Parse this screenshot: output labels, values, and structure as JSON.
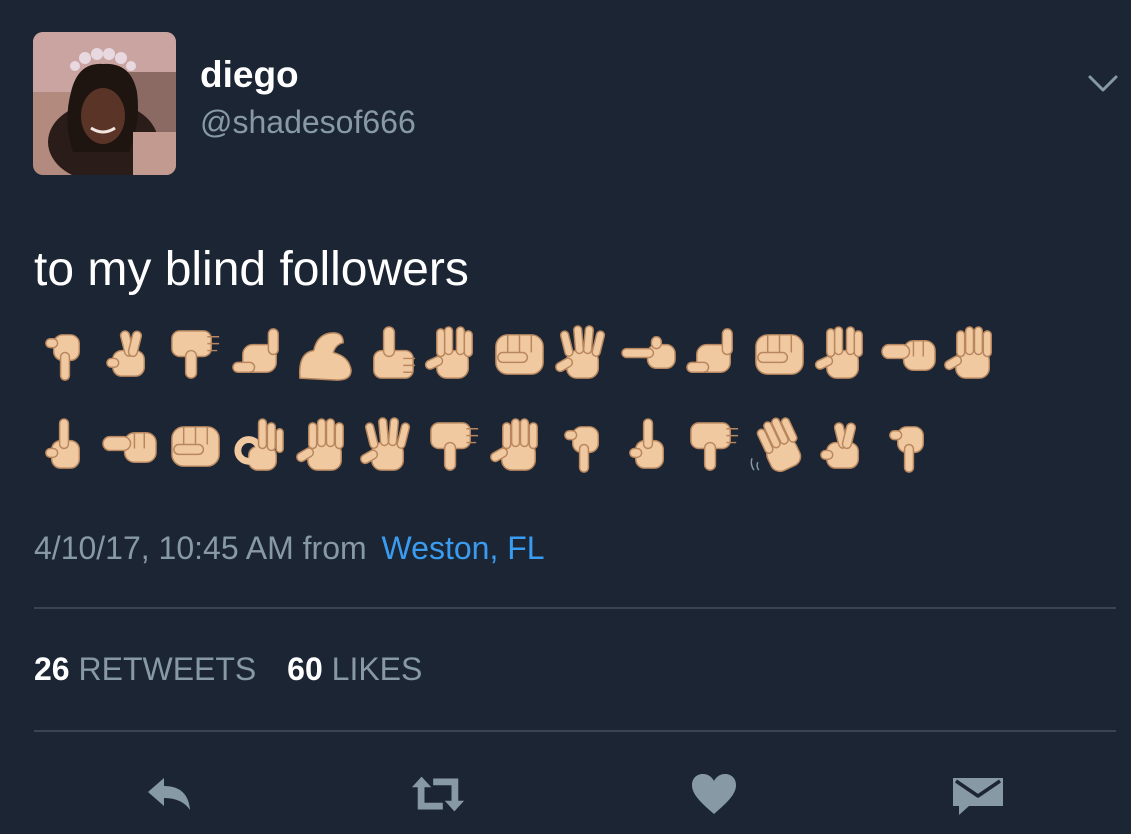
{
  "tweet": {
    "display_name": "diego",
    "username": "@shadesof666",
    "text": "to my blind followers",
    "emoji_rows": [
      [
        "point-down",
        "crossed-fingers",
        "thumbs-down",
        "call-me-hand",
        "flexed-biceps",
        "thumbs-up",
        "vulcan-salute",
        "fist-bump",
        "splayed-hand",
        "point-left",
        "call-me-hand",
        "fist-bump",
        "vulcan-salute",
        "fist-right",
        "raised-hand"
      ],
      [
        "point-up",
        "fist-right",
        "fist-bump",
        "ok-hand",
        "raised-hand",
        "splayed-hand",
        "thumbs-down",
        "raised-hand",
        "point-down",
        "point-up",
        "thumbs-down",
        "waving-hand",
        "crossed-fingers",
        "point-down"
      ]
    ],
    "timestamp": "4/10/17, 10:45 AM",
    "from_label": "from",
    "location": "Weston, FL"
  },
  "stats": {
    "retweets_count": "26",
    "retweets_label": "RETWEETS",
    "likes_count": "60",
    "likes_label": "LIKES"
  },
  "actions": [
    "reply-icon",
    "retweet-icon",
    "like-icon",
    "direct-message-icon"
  ],
  "colors": {
    "background": "#1b2533",
    "text_primary": "#ffffff",
    "text_secondary": "#8899a6",
    "link": "#3a9cf0",
    "divider": "#3a4552",
    "icon": "#8899a6",
    "skin_tone": "#f1c9a0"
  }
}
